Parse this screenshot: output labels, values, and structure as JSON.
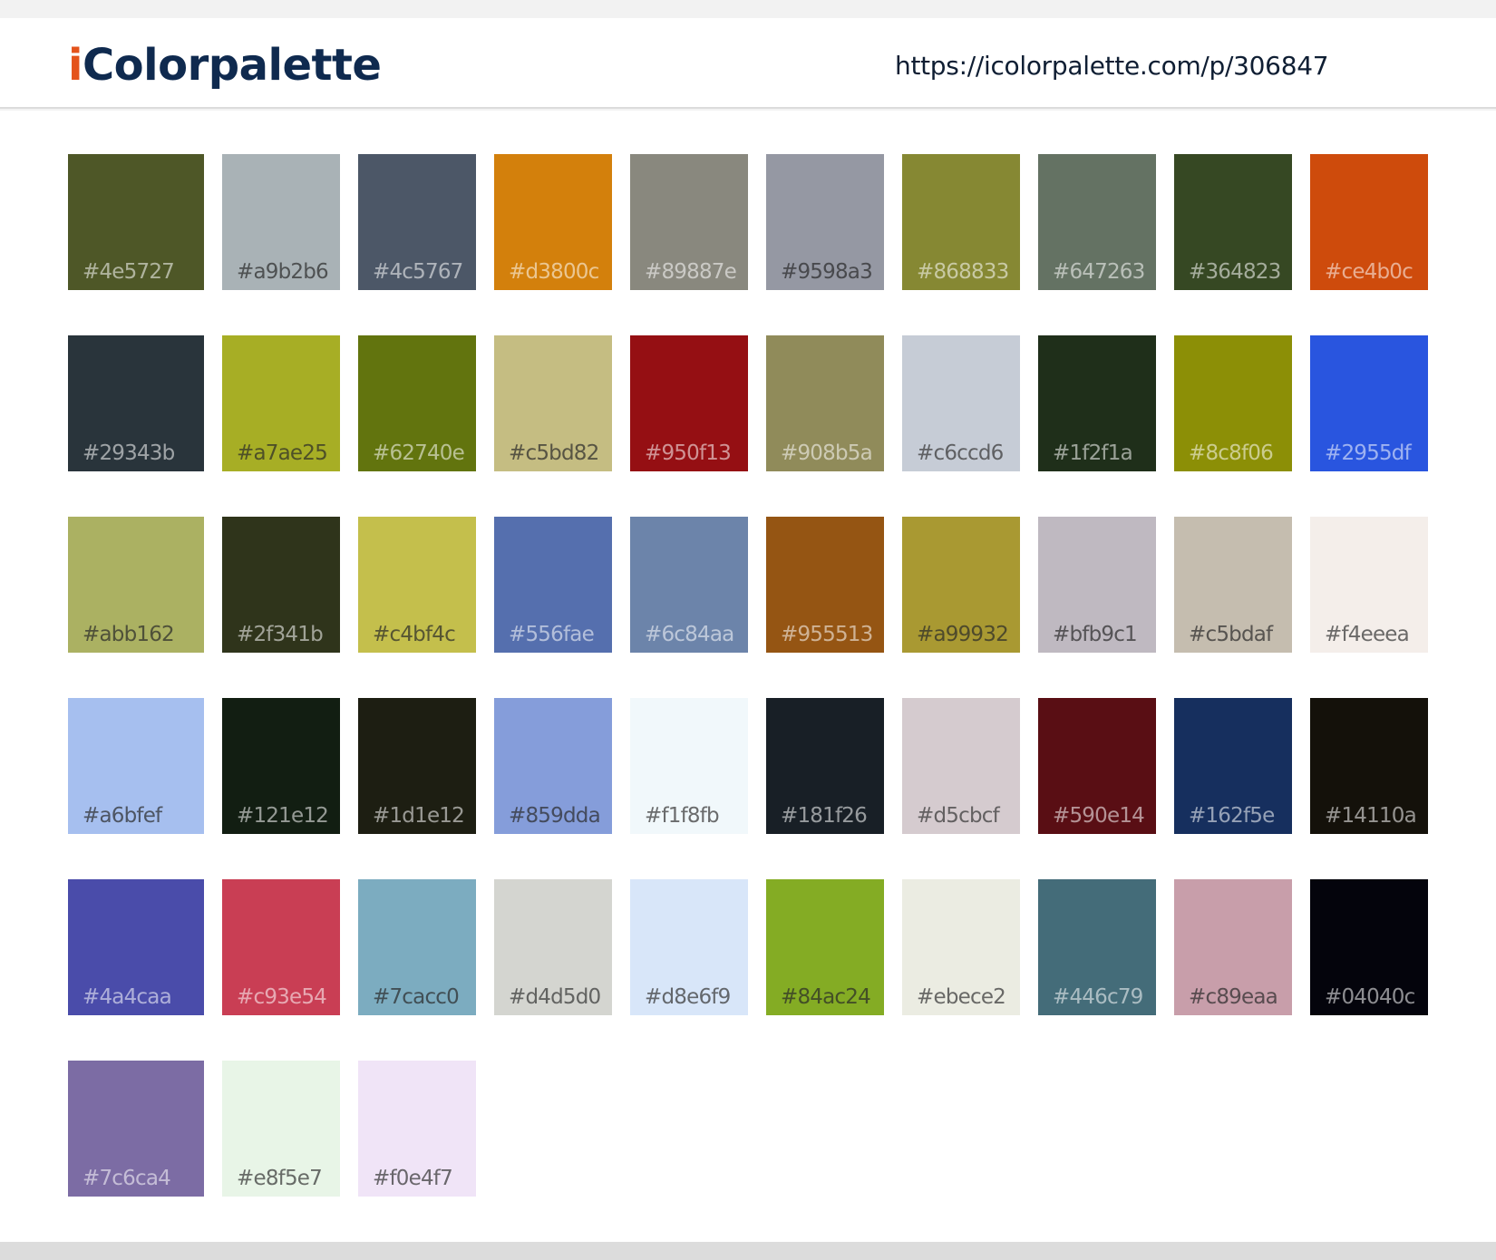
{
  "header": {
    "logo_i": "i",
    "logo_rest": "Colorpalette",
    "url": "https://icolorpalette.com/p/306847"
  },
  "colors": {
    "logo_accent": "#e4531b",
    "logo_main": "#0f2a4f"
  },
  "swatches": [
    [
      "#4e5727",
      "#a9b2b6",
      "#4c5767",
      "#d3800c",
      "#89887e",
      "#9598a3",
      "#868833",
      "#647263",
      "#364823",
      "#ce4b0c"
    ],
    [
      "#29343b",
      "#a7ae25",
      "#62740e",
      "#c5bd82",
      "#950f13",
      "#908b5a",
      "#c6ccd6",
      "#1f2f1a",
      "#8c8f06",
      "#2955df"
    ],
    [
      "#abb162",
      "#2f341b",
      "#c4bf4c",
      "#556fae",
      "#6c84aa",
      "#955513",
      "#a99932",
      "#bfb9c1",
      "#c5bdaf",
      "#f4eeea"
    ],
    [
      "#a6bfef",
      "#121e12",
      "#1d1e12",
      "#859dda",
      "#f1f8fb",
      "#181f26",
      "#d5cbcf",
      "#590e14",
      "#162f5e",
      "#14110a"
    ],
    [
      "#4a4caa",
      "#c93e54",
      "#7cacc0",
      "#d4d5d0",
      "#d8e6f9",
      "#84ac24",
      "#ebece2",
      "#446c79",
      "#c89eaa",
      "#04040c"
    ],
    [
      "#7c6ca4",
      "#e8f5e7",
      "#f0e4f7"
    ]
  ]
}
